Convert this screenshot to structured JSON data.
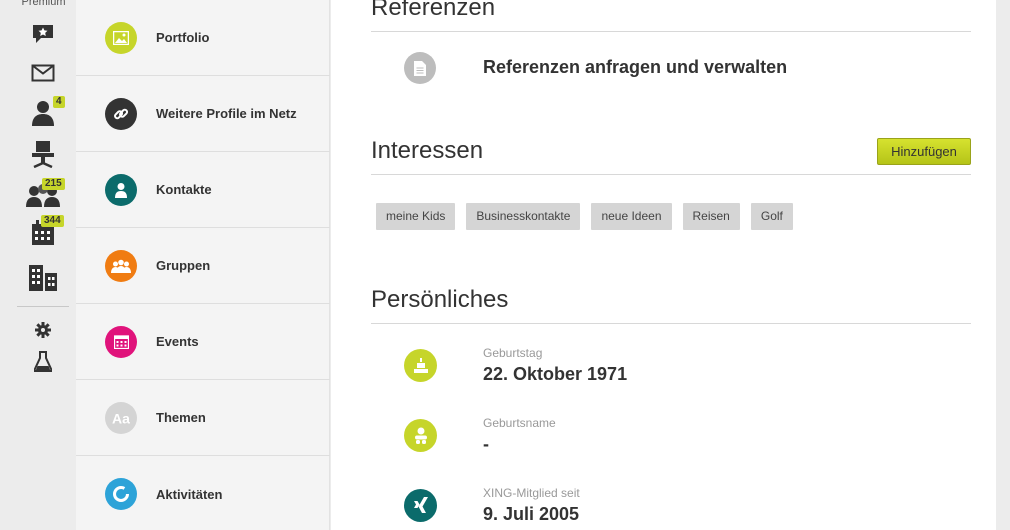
{
  "rail": {
    "premium_label": "Premium",
    "contacts_badge": "4",
    "groups_badge": "215",
    "events_badge": "344"
  },
  "nav": {
    "items": [
      {
        "label": "Portfolio",
        "color": "#c6d52a",
        "icon": "image-icon"
      },
      {
        "label": "Weitere Profile im Netz",
        "color": "#333333",
        "icon": "link-icon"
      },
      {
        "label": "Kontakte",
        "color": "#0b6b6b",
        "icon": "person-icon"
      },
      {
        "label": "Gruppen",
        "color": "#f07c12",
        "icon": "people-group-icon"
      },
      {
        "label": "Events",
        "color": "#e0137b",
        "icon": "calendar-icon"
      },
      {
        "label": "Themen",
        "color": "#d4d4d4",
        "icon": "font-aa-icon"
      },
      {
        "label": "Aktivitäten",
        "color": "#2da3d8",
        "icon": "activity-ring-icon"
      }
    ]
  },
  "main": {
    "referenzen": {
      "title": "Referenzen",
      "link_text": "Referenzen anfragen und verwalten"
    },
    "interessen": {
      "title": "Interessen",
      "add_button": "Hinzufügen",
      "tags": [
        "meine Kids",
        "Businesskontakte",
        "neue Ideen",
        "Reisen",
        "Golf"
      ]
    },
    "persoenliches": {
      "title": "Persönliches",
      "rows": [
        {
          "label": "Geburtstag",
          "value": "22. Oktober 1971",
          "icon": "birthday-cake-icon",
          "color": "#c6d52a"
        },
        {
          "label": "Geburtsname",
          "value": "-",
          "icon": "baby-icon",
          "color": "#c6d52a"
        },
        {
          "label": "XING-Mitglied seit",
          "value": "9. Juli 2005",
          "icon": "xing-logo-icon",
          "color": "#0b6b6b"
        }
      ]
    }
  },
  "colors": {
    "accent_green": "#c6d52a",
    "text_dark": "#333333",
    "muted_label": "#999999"
  }
}
